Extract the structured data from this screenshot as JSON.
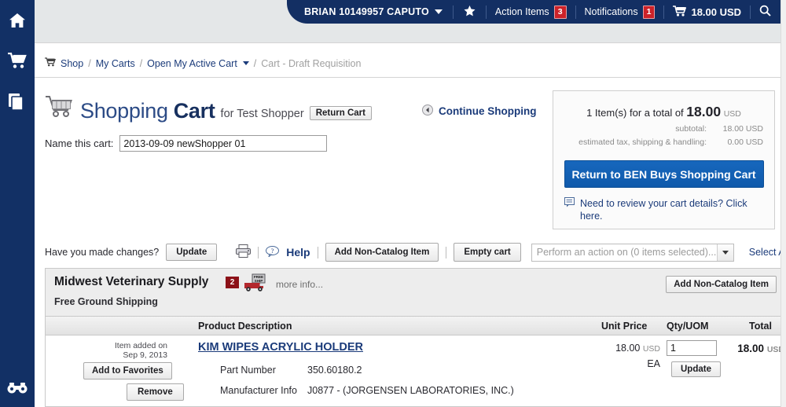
{
  "rail": {
    "items": [
      {
        "icon": "home-icon",
        "name": "home"
      },
      {
        "icon": "shopping-cart-icon",
        "name": "shop"
      },
      {
        "icon": "documents-icon",
        "name": "orders"
      }
    ],
    "bottom": {
      "icon": "binoculars-icon",
      "name": "search-watch"
    }
  },
  "topbar": {
    "user": "BRIAN 10149957 CAPUTO",
    "star_icon": "star-icon",
    "action_items_label": "Action Items",
    "action_items_count": "3",
    "notifications_label": "Notifications",
    "notifications_count": "1",
    "cart_icon": "cart-icon",
    "cart_amount": "18.00 USD",
    "search_icon": "search-icon"
  },
  "breadcrumb": {
    "cart_icon": "cart-icon",
    "shop": "Shop",
    "my_carts": "My Carts",
    "active_cart": "Open My Active Cart",
    "current": "Cart - Draft Requisition",
    "sep": "/"
  },
  "title": {
    "word1": "Shopping",
    "word2": "Cart",
    "for": "for Test Shopper",
    "return_cart": "Return Cart"
  },
  "name_cart": {
    "label": "Name this cart:",
    "value": "2013-09-09 newShopper 01"
  },
  "continue_shopping": {
    "label": "Continue Shopping",
    "icon": "back-arrow-icon"
  },
  "summary": {
    "items_prefix": "1 Item(s)",
    "total_prefix": "for a total of",
    "total": "18.00",
    "currency": "USD",
    "subtotal_label": "subtotal:",
    "subtotal_value": "18.00 USD",
    "tax_label": "estimated tax, shipping & handling:",
    "tax_value": "0.00 USD",
    "return_button": "Return to BEN Buys Shopping Cart",
    "note": "Need to review your cart details? Click here.",
    "note_icon": "comment-icon"
  },
  "toolbar": {
    "question": "Have you made changes?",
    "update": "Update",
    "print_icon": "printer-icon",
    "help_icon": "help-bubble-icon",
    "help": "Help",
    "add_non_catalog": "Add Non-Catalog Item",
    "empty_cart": "Empty cart",
    "action_placeholder": "Perform an action on (0 items selected)...",
    "select_all": "Select A"
  },
  "supplier": {
    "name": "Midwest Veterinary Supply",
    "flag_count": "2",
    "free_shipping_icon": "free-shipping-truck-icon",
    "more_info": "more info...",
    "free_ground_shipping": "Free Ground Shipping",
    "add_non_catalog": "Add Non-Catalog Item"
  },
  "table": {
    "headers": {
      "description": "Product Description",
      "unit_price": "Unit Price",
      "qty_uom": "Qty/UOM",
      "total": "Total"
    },
    "rows": [
      {
        "added_on_label": "Item added on",
        "added_on_date": "Sep 9, 2013",
        "add_to_favorites": "Add to Favorites",
        "remove": "Remove",
        "product_name": "KIM WIPES ACRYLIC HOLDER",
        "part_number_label": "Part Number",
        "part_number": "350.60180.2",
        "manufacturer_label": "Manufacturer Info",
        "manufacturer": "J0877 - (JORGENSEN LABORATORIES, INC.)",
        "unit_price": "18.00",
        "unit_currency": "USD",
        "uom": "EA",
        "qty": "1",
        "update": "Update",
        "total": "18.00",
        "total_currency": "USD"
      }
    ]
  },
  "colors": {
    "nav_blue": "#123065",
    "topbar_blue": "#132f63",
    "link_blue": "#1b3b7a",
    "accent_blue": "#0f5aab",
    "badge_red": "#cc2229",
    "flag_red": "#8c1118"
  }
}
